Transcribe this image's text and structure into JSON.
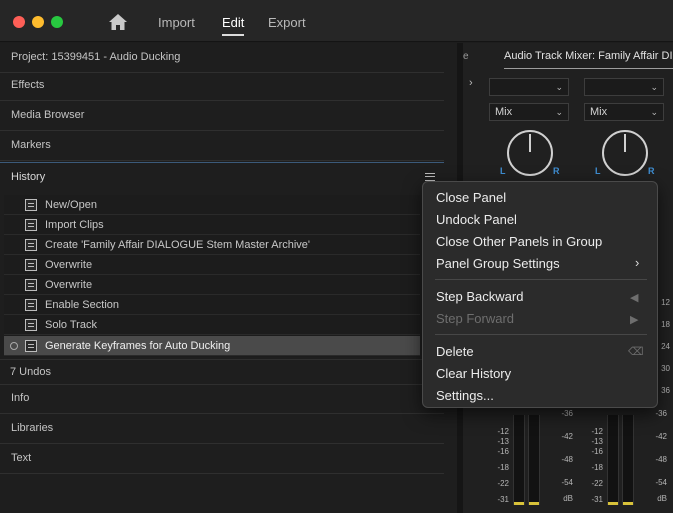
{
  "window": {
    "nav": [
      "Import",
      "Edit",
      "Export"
    ],
    "active_nav": "Edit"
  },
  "left_panel": {
    "project": "Project: 15399451 - Audio Ducking",
    "effects": "Effects",
    "media_browser": "Media Browser",
    "markers": "Markers",
    "history": "History",
    "history_items": [
      "New/Open",
      "Import Clips",
      "Create 'Family Affair DIALOGUE Stem Master Archive'",
      "Overwrite",
      "Overwrite",
      "Enable Section",
      "Solo Track",
      "Generate Keyframes for Auto Ducking"
    ],
    "undos": "7 Undos",
    "info": "Info",
    "libraries": "Libraries",
    "text": "Text"
  },
  "mixer": {
    "tab": "Audio Track Mixer: Family Affair DI",
    "channel_1": {
      "mode": "Mix",
      "l": "L",
      "r": "R"
    },
    "channel_2": {
      "mode": "Mix",
      "l": "L",
      "r": "R"
    },
    "scale_left_1": [
      "-12",
      "-13",
      "-16",
      "-18",
      "-22",
      "-31",
      "-∞"
    ],
    "scale_mid": [
      "-36",
      "-42",
      "-48",
      "-54",
      "dB"
    ],
    "scale_left_2": [
      "-12",
      "-13",
      "-16",
      "-18",
      "-22",
      "-31",
      "-∞"
    ],
    "scale_right": [
      "12",
      "18",
      "24",
      "30",
      "36",
      "-36",
      "-42",
      "-48",
      "-54",
      "dB"
    ]
  },
  "context_menu": {
    "close_panel": "Close Panel",
    "undock_panel": "Undock Panel",
    "close_other": "Close Other Panels in Group",
    "panel_group_settings": "Panel Group Settings",
    "step_backward": "Step Backward",
    "step_forward": "Step Forward",
    "delete": "Delete",
    "clear_history": "Clear History",
    "settings": "Settings..."
  },
  "colors": {
    "accent_blue": "#3f8fd4",
    "meter_yellow": "#d8c23a"
  }
}
